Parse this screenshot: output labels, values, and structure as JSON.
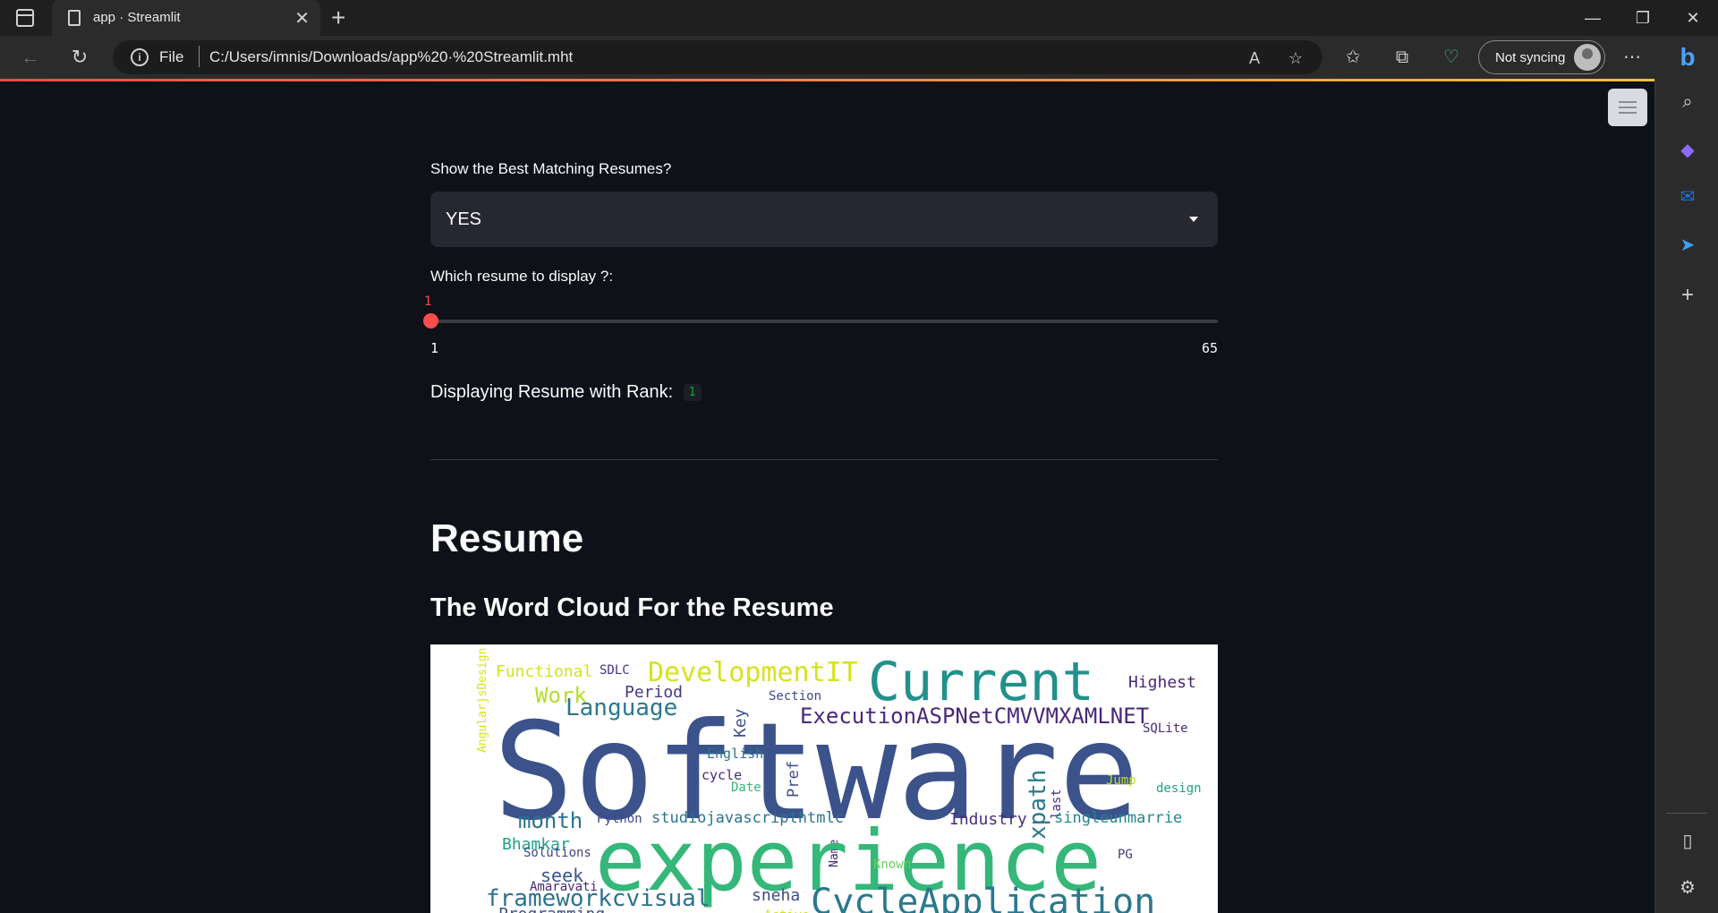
{
  "browser": {
    "tab_title": "app · Streamlit",
    "address_scheme": "File",
    "address_url": "C:/Users/imnis/Downloads/app%20·%20Streamlit.mht",
    "sync_label": "Not syncing"
  },
  "app": {
    "select_label": "Show the Best Matching Resumes?",
    "select_value": "YES",
    "slider_label": "Which resume to display ?:",
    "slider_value": "1",
    "slider_min": "1",
    "slider_max": "65",
    "slider_fraction": 0.0,
    "rank_label": "Displaying Resume with Rank:",
    "rank_value": "1",
    "heading": "Resume",
    "subheading": "The Word Cloud For the Resume"
  },
  "wordcloud": {
    "words": [
      {
        "text": "Functional",
        "color": "#d6e21f"
      },
      {
        "text": "SDLC",
        "color": "#46327e"
      },
      {
        "text": "DevelopmentIT",
        "color": "#d6e21f"
      },
      {
        "text": "Current",
        "color": "#21918c"
      },
      {
        "text": "Highest",
        "color": "#482878"
      },
      {
        "text": "Work",
        "color": "#b5de2b"
      },
      {
        "text": "Period",
        "color": "#443983"
      },
      {
        "text": "Key",
        "color": "#3b528b"
      },
      {
        "text": "Section",
        "color": "#3e4989"
      },
      {
        "text": "Language",
        "color": "#2a788e"
      },
      {
        "text": "ExecutionASPNetCMVVMXAMLNET",
        "color": "#482878"
      },
      {
        "text": "SQLite",
        "color": "#472d7b"
      },
      {
        "text": "AngularjsDesign",
        "color": "#d8e219"
      },
      {
        "text": "Software",
        "color": "#3b528b"
      },
      {
        "text": "English",
        "color": "#2c728e"
      },
      {
        "text": "Pref",
        "color": "#3e4a89"
      },
      {
        "text": "cycle",
        "color": "#472c7a"
      },
      {
        "text": "Date",
        "color": "#35b779"
      },
      {
        "text": "xpath",
        "color": "#2a788e"
      },
      {
        "text": "last",
        "color": "#46307e"
      },
      {
        "text": "Jump",
        "color": "#bddf26"
      },
      {
        "text": "design",
        "color": "#1fa187"
      },
      {
        "text": "month",
        "color": "#2d708e"
      },
      {
        "text": "Python",
        "color": "#3f4788"
      },
      {
        "text": "studiojavascripthtmlc",
        "color": "#2c728e"
      },
      {
        "text": "Industry",
        "color": "#472f7d"
      },
      {
        "text": "singleunmarrie",
        "color": "#25848e"
      },
      {
        "text": "Bhamkar",
        "color": "#1fa187"
      },
      {
        "text": "Name",
        "color": "#482475"
      },
      {
        "text": "Solutions",
        "color": "#3f4788"
      },
      {
        "text": "experience",
        "color": "#35b779"
      },
      {
        "text": "seek",
        "color": "#3a548c"
      },
      {
        "text": "Known",
        "color": "#6ccd5a"
      },
      {
        "text": "PG",
        "color": "#443983"
      },
      {
        "text": "Amaravati",
        "color": "#482677"
      },
      {
        "text": "frameworkcvisual",
        "color": "#2c728e"
      },
      {
        "text": "sneha",
        "color": "#3e4a89"
      },
      {
        "text": "CycleApplication",
        "color": "#2a788e"
      },
      {
        "text": "Programming",
        "color": "#3b528b"
      },
      {
        "text": "Active",
        "color": "#d8e219"
      }
    ]
  }
}
